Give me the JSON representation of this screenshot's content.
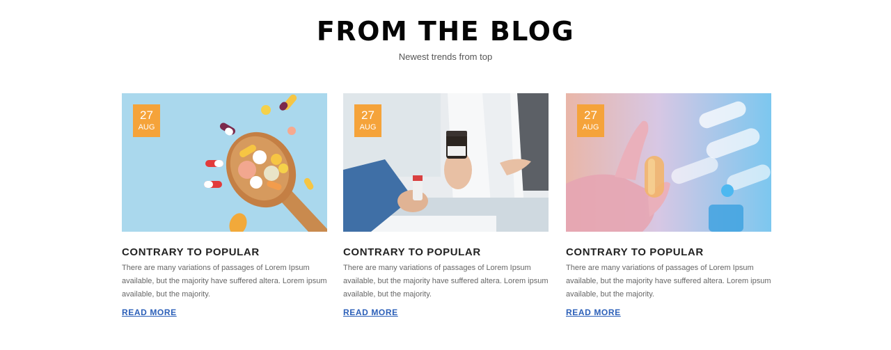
{
  "section": {
    "title": "FROM THE BLOG",
    "subtitle": "Newest trends from top"
  },
  "posts": [
    {
      "day": "27",
      "month": "AUG",
      "title": "CONTRARY TO POPULAR",
      "excerpt": "There are many variations of passages of Lorem Ipsum available, but the majority have suffered altera. Lorem ipsum available, but the majority.",
      "read_more": "READ MORE",
      "image": "pills-on-spoon"
    },
    {
      "day": "27",
      "month": "AUG",
      "title": "CONTRARY TO POPULAR",
      "excerpt": "There are many variations of passages of Lorem Ipsum available, but the majority have suffered altera. Lorem ipsum available, but the majority.",
      "read_more": "READ MORE",
      "image": "pharmacist-with-bottle"
    },
    {
      "day": "27",
      "month": "AUG",
      "title": "CONTRARY TO POPULAR",
      "excerpt": "There are many variations of passages of Lorem Ipsum available, but the majority have suffered altera. Lorem ipsum available, but the majority.",
      "read_more": "READ MORE",
      "image": "gloved-hand-with-capsule"
    }
  ],
  "colors": {
    "badge": "#f5a33a",
    "link": "#2b5fb8"
  }
}
